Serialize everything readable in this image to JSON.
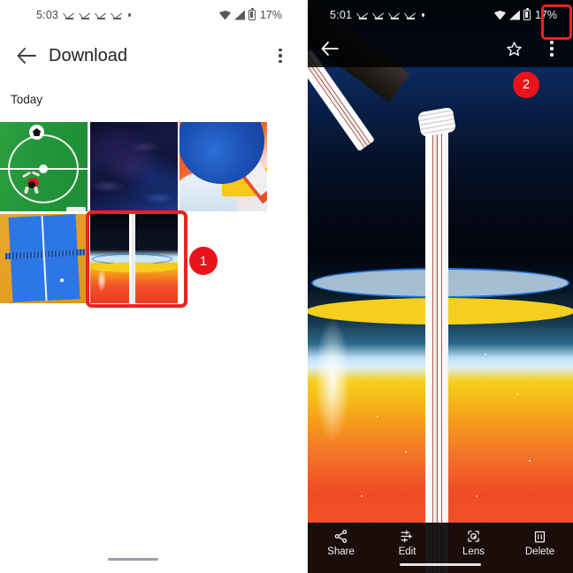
{
  "left_panel": {
    "status_bar": {
      "time": "5:03",
      "download_icons_count": 4,
      "extra_dot": true,
      "wifi_icon": "wifi-icon",
      "signal_icon": "cellular-signal-icon",
      "battery_icon": "battery-icon",
      "battery_text": "17%"
    },
    "app_bar": {
      "back_icon": "back-arrow-icon",
      "title": "Download",
      "overflow_icon": "overflow-menu-icon"
    },
    "section_label": "Today",
    "thumbnails": [
      {
        "name": "soccer-field-thumbnail",
        "selected": false
      },
      {
        "name": "dark-marble-thumbnail",
        "selected": false
      },
      {
        "name": "abstract-sphere-thumbnail",
        "selected": false
      },
      {
        "name": "ping-pong-table-thumbnail",
        "selected": false
      },
      {
        "name": "orange-drink-thumbnail",
        "selected": true
      }
    ],
    "annotation_badge": "1",
    "home_indicator": "home-indicator"
  },
  "right_panel": {
    "status_bar": {
      "time": "5:01",
      "download_icons_count": 4,
      "extra_dot": true,
      "wifi_icon": "wifi-icon",
      "signal_icon": "cellular-signal-icon",
      "battery_icon": "battery-icon",
      "battery_text": "17%"
    },
    "app_bar": {
      "back_icon": "back-arrow-icon",
      "star_icon": "star-outline-icon",
      "overflow_icon": "overflow-menu-icon"
    },
    "photo": {
      "description": "orange drink in a glass with a bendy straw against a dark blue sky"
    },
    "annotation_badge": "2",
    "bottom_bar": [
      {
        "icon": "share-icon",
        "label": "Share"
      },
      {
        "icon": "edit-sliders-icon",
        "label": "Edit"
      },
      {
        "icon": "google-lens-icon",
        "label": "Lens"
      },
      {
        "icon": "trash-delete-icon",
        "label": "Delete"
      }
    ],
    "home_indicator": "home-indicator"
  },
  "colors": {
    "annotation_red": "#e8131b",
    "highlight_border": "#ee2222",
    "app_bar_text": "#202124",
    "status_icon": "#5a5a5a"
  }
}
